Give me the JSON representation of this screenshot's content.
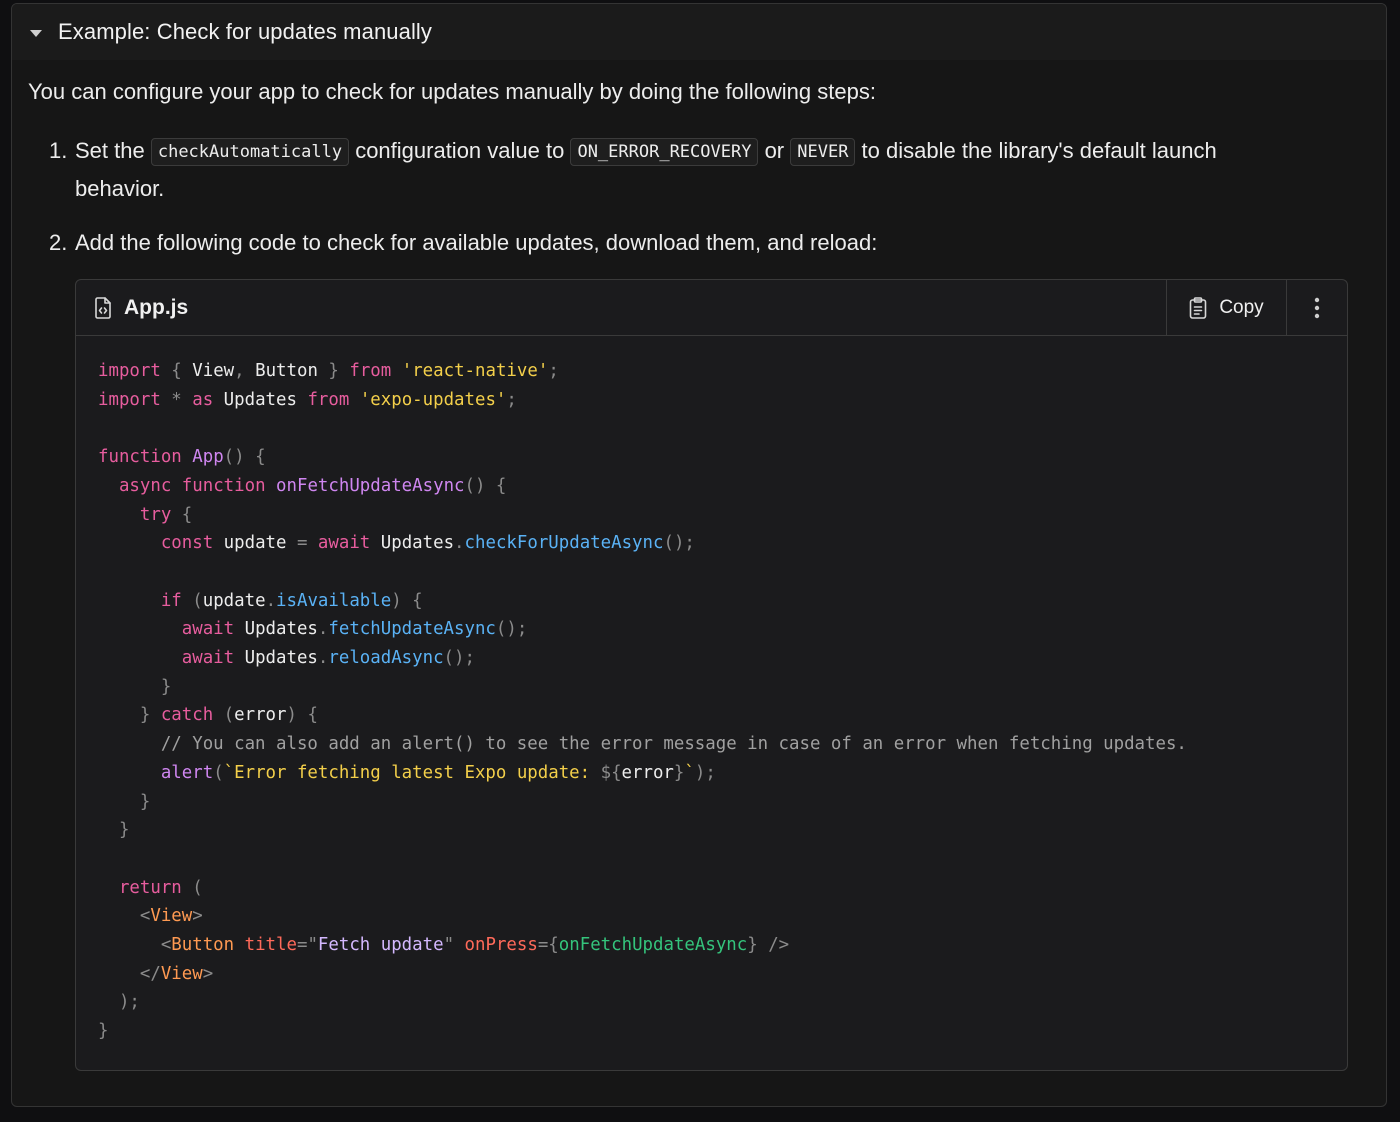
{
  "details": {
    "summary": "Example: Check for updates manually",
    "intro": "You can configure your app to check for updates manually by doing the following steps:",
    "steps": [
      {
        "number": "1.",
        "text_1": "Set the ",
        "code_1": "checkAutomatically",
        "text_2": " configuration value to ",
        "code_2": "ON_ERROR_RECOVERY",
        "text_3": " or ",
        "code_3": "NEVER",
        "text_4": " to disable the library's default launch behavior."
      },
      {
        "number": "2.",
        "text": "Add the following code to check for available updates, download them, and reload:"
      }
    ]
  },
  "code_block": {
    "filename": "App.js",
    "file_icon": "file-code-icon",
    "copy_label": "Copy",
    "copy_icon": "clipboard-icon",
    "more_icon": "more-vertical-icon",
    "lines": [
      [
        [
          "k",
          "import"
        ],
        [
          "p",
          " { "
        ],
        [
          "v",
          "View"
        ],
        [
          "p",
          ", "
        ],
        [
          "v",
          "Button"
        ],
        [
          "p",
          " } "
        ],
        [
          "k",
          "from"
        ],
        [
          "v",
          " "
        ],
        [
          "s",
          "'react-native'"
        ],
        [
          "p",
          ";"
        ]
      ],
      [
        [
          "k",
          "import"
        ],
        [
          "p",
          " * "
        ],
        [
          "k",
          "as"
        ],
        [
          "v",
          " Updates "
        ],
        [
          "k",
          "from"
        ],
        [
          "v",
          " "
        ],
        [
          "s",
          "'expo-updates'"
        ],
        [
          "p",
          ";"
        ]
      ],
      [],
      [
        [
          "k",
          "function"
        ],
        [
          "v",
          " "
        ],
        [
          "f",
          "App"
        ],
        [
          "p",
          "() {"
        ]
      ],
      [
        [
          "v",
          "  "
        ],
        [
          "k",
          "async"
        ],
        [
          "v",
          " "
        ],
        [
          "k",
          "function"
        ],
        [
          "v",
          " "
        ],
        [
          "f",
          "onFetchUpdateAsync"
        ],
        [
          "p",
          "() {"
        ]
      ],
      [
        [
          "v",
          "    "
        ],
        [
          "k",
          "try"
        ],
        [
          "p",
          " {"
        ]
      ],
      [
        [
          "v",
          "      "
        ],
        [
          "k",
          "const"
        ],
        [
          "v",
          " update "
        ],
        [
          "p",
          "="
        ],
        [
          "v",
          " "
        ],
        [
          "k",
          "await"
        ],
        [
          "v",
          " Updates"
        ],
        [
          "p",
          "."
        ],
        [
          "m",
          "checkForUpdateAsync"
        ],
        [
          "p",
          "();"
        ]
      ],
      [],
      [
        [
          "v",
          "      "
        ],
        [
          "k",
          "if"
        ],
        [
          "p",
          " ("
        ],
        [
          "v",
          "update"
        ],
        [
          "p",
          "."
        ],
        [
          "m",
          "isAvailable"
        ],
        [
          "p",
          ") {"
        ]
      ],
      [
        [
          "v",
          "        "
        ],
        [
          "k",
          "await"
        ],
        [
          "v",
          " Updates"
        ],
        [
          "p",
          "."
        ],
        [
          "m",
          "fetchUpdateAsync"
        ],
        [
          "p",
          "();"
        ]
      ],
      [
        [
          "v",
          "        "
        ],
        [
          "k",
          "await"
        ],
        [
          "v",
          " Updates"
        ],
        [
          "p",
          "."
        ],
        [
          "m",
          "reloadAsync"
        ],
        [
          "p",
          "();"
        ]
      ],
      [
        [
          "p",
          "      }"
        ]
      ],
      [
        [
          "p",
          "    } "
        ],
        [
          "k",
          "catch"
        ],
        [
          "p",
          " ("
        ],
        [
          "v",
          "error"
        ],
        [
          "p",
          ") {"
        ]
      ],
      [
        [
          "v",
          "      "
        ],
        [
          "c",
          "// You can also add an alert() to see the error message in case of an error when fetching updates."
        ]
      ],
      [
        [
          "v",
          "      "
        ],
        [
          "f",
          "alert"
        ],
        [
          "p",
          "("
        ],
        [
          "s",
          "`Error fetching latest Expo update: "
        ],
        [
          "p",
          "${"
        ],
        [
          "v",
          "error"
        ],
        [
          "p",
          "}"
        ],
        [
          "s",
          "`"
        ],
        [
          "p",
          ");"
        ]
      ],
      [
        [
          "p",
          "    }"
        ]
      ],
      [
        [
          "p",
          "  }"
        ]
      ],
      [],
      [
        [
          "v",
          "  "
        ],
        [
          "k",
          "return"
        ],
        [
          "p",
          " ("
        ]
      ],
      [
        [
          "p",
          "    <"
        ],
        [
          "t",
          "View"
        ],
        [
          "p",
          ">"
        ]
      ],
      [
        [
          "p",
          "      <"
        ],
        [
          "t",
          "Button"
        ],
        [
          "v",
          " "
        ],
        [
          "a",
          "title"
        ],
        [
          "p",
          "=\""
        ],
        [
          "av",
          "Fetch update"
        ],
        [
          "p",
          "\""
        ],
        [
          "v",
          " "
        ],
        [
          "a",
          "onPress"
        ],
        [
          "p",
          "={"
        ],
        [
          "g",
          "onFetchUpdateAsync"
        ],
        [
          "p",
          "} />"
        ]
      ],
      [
        [
          "p",
          "    </"
        ],
        [
          "t",
          "View"
        ],
        [
          "p",
          ">"
        ]
      ],
      [
        [
          "p",
          "  );"
        ]
      ],
      [
        [
          "p",
          "}"
        ]
      ]
    ]
  }
}
